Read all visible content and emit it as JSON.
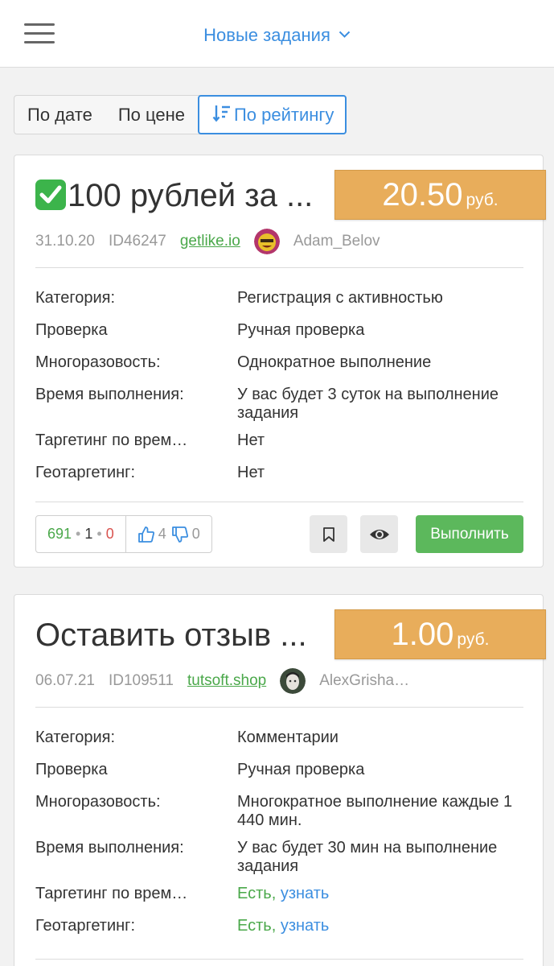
{
  "header": {
    "menu_icon": "hamburger-menu-icon",
    "title": "Новые задания",
    "dropdown_icon": "chevron-down-icon"
  },
  "sort": {
    "by_date": "По дате",
    "by_price": "По цене",
    "by_rating": "По рейтингу",
    "active": "by_rating",
    "active_icon": "sort-descending-icon"
  },
  "colors": {
    "accent_blue": "#3b8ee0",
    "price_orange": "#e8ad5b",
    "success_green": "#5cb85c",
    "link_green": "#4aa84a",
    "reject_red": "#d9534f"
  },
  "tasks": [
    {
      "title_emoji": "check-mark-button-emoji",
      "title": "100 рублей за ...",
      "price": "20.50",
      "currency": "руб.",
      "date": "31.10.20",
      "id": "ID46247",
      "domain": "getlike.io",
      "author": "Adam_Belov",
      "props": [
        {
          "key": "Категория:",
          "value": "Регистрация с активностью"
        },
        {
          "key": "Проверка",
          "value": "Ручная проверка"
        },
        {
          "key": "Многоразовость:",
          "value": "Однократное выполнение"
        },
        {
          "key": "Время выполнения:",
          "value": "У вас будет 3 суток на выполнение задания"
        },
        {
          "key": "Таргетинг по врем…",
          "value": "Нет"
        },
        {
          "key": "Геотаргетинг:",
          "value": "Нет"
        }
      ],
      "stats": {
        "done": "691",
        "waiting": "1",
        "rejected": "0"
      },
      "likes": "4",
      "dislikes": "0",
      "action_label": "Выполнить"
    },
    {
      "title": "Оставить отзыв ...",
      "price": "1.00",
      "currency": "руб.",
      "date": "06.07.21",
      "id": "ID109511",
      "domain": "tutsoft.shop",
      "author": "AlexGrisha…",
      "props": [
        {
          "key": "Категория:",
          "value": "Комментарии"
        },
        {
          "key": "Проверка",
          "value": "Ручная проверка"
        },
        {
          "key": "Многоразовость:",
          "value": "Многократное выполнение каждые 1 440 мин."
        },
        {
          "key": "Время выполнения:",
          "value": "У вас будет 30 мин на выполнение задания"
        },
        {
          "key": "Таргетинг по врем…",
          "value": "Есть,",
          "link": "узнать"
        },
        {
          "key": "Геотаргетинг:",
          "value": "Есть,",
          "link": "узнать"
        }
      ]
    }
  ]
}
